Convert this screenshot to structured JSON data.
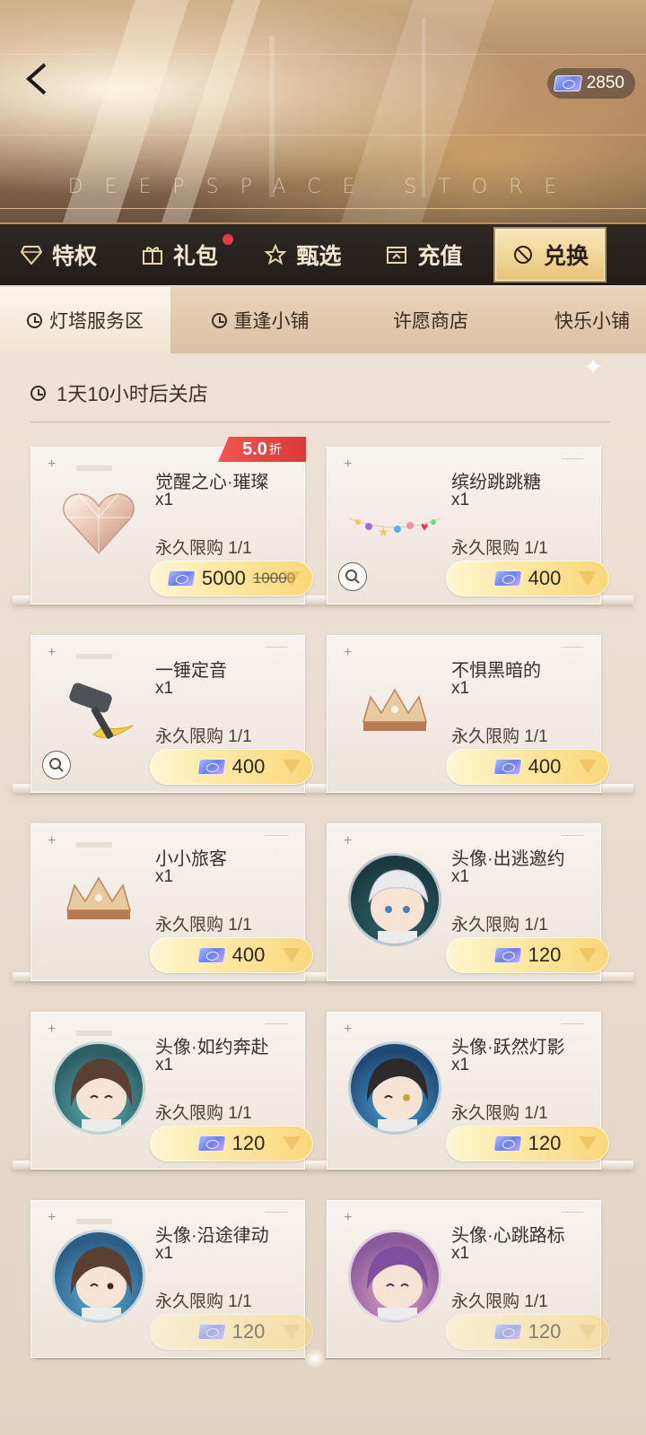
{
  "header": {
    "banner_title": "DEEPSPACE STORE",
    "currency_amount": "2850"
  },
  "main_tabs": [
    {
      "label": "特权",
      "icon": "diamond-icon"
    },
    {
      "label": "礼包",
      "icon": "gift-icon",
      "badge": true
    },
    {
      "label": "甄选",
      "icon": "star-icon"
    },
    {
      "label": "充值",
      "icon": "topup-icon"
    },
    {
      "label": "兑换",
      "icon": "exchange-icon",
      "active": true
    }
  ],
  "sub_tabs": [
    {
      "label": "灯塔服务区",
      "active": true
    },
    {
      "label": "重逢小铺"
    },
    {
      "label": "许愿商店"
    },
    {
      "label": "快乐小铺"
    }
  ],
  "timer": "1天10小时后关店",
  "items": [
    {
      "name": "觉醒之心·璀璨",
      "qty": "x1",
      "limit": "永久限购 1/1",
      "price": "5000",
      "old_price": "10000",
      "discount": "5.0",
      "discount_unit": "折",
      "thumb": "heart-gem-icon"
    },
    {
      "name": "缤纷跳跳糖",
      "qty": "x1",
      "limit": "永久限购 1/1",
      "price": "400",
      "thumb": "candy-string-icon",
      "preview": true
    },
    {
      "name": "一锤定音",
      "qty": "x1",
      "limit": "永久限购 1/1",
      "price": "400",
      "thumb": "hammer-icon",
      "preview": true
    },
    {
      "name": "不惧黑暗的",
      "qty": "x1",
      "limit": "永久限购 1/1",
      "price": "400",
      "thumb": "crown-icon"
    },
    {
      "name": "小小旅客",
      "qty": "x1",
      "limit": "永久限购 1/1",
      "price": "400",
      "thumb": "crown-icon"
    },
    {
      "name": "头像·出逃邀约",
      "qty": "x1",
      "limit": "永久限购 1/1",
      "price": "120",
      "thumb": "avatar-white-hair-icon"
    },
    {
      "name": "头像·如约奔赴",
      "qty": "x1",
      "limit": "永久限购 1/1",
      "price": "120",
      "thumb": "avatar-brown-hair-icon"
    },
    {
      "name": "头像·跃然灯影",
      "qty": "x1",
      "limit": "永久限购 1/1",
      "price": "120",
      "thumb": "avatar-dark-hair-icon"
    },
    {
      "name": "头像·沿途律动",
      "qty": "x1",
      "limit": "永久限购 1/1",
      "price": "120",
      "thumb": "avatar-brown-hair-icon"
    },
    {
      "name": "头像·心跳路标",
      "qty": "x1",
      "limit": "永久限购 1/1",
      "price": "120",
      "thumb": "avatar-purple-hair-icon"
    }
  ],
  "colors": {
    "accent_gold": "#f9d77a",
    "discount_red": "#e8394a",
    "tab_bar_bg": "#2f2823"
  }
}
